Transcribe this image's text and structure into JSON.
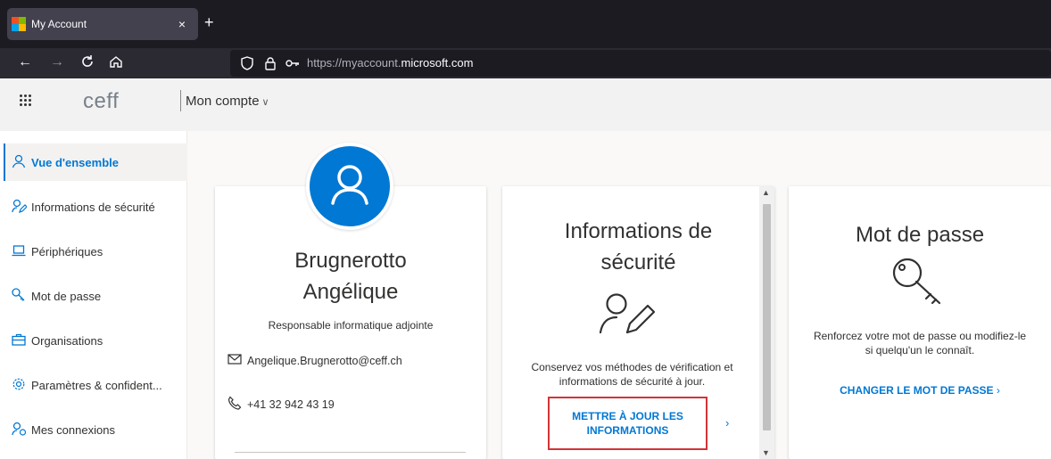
{
  "browser": {
    "tab_title": "My Account",
    "tab_close": "×",
    "new_tab": "+",
    "url_prefix": "https://myaccount.",
    "url_domain": "microsoft.com"
  },
  "header": {
    "brand": "ceff",
    "account_menu": "Mon compte"
  },
  "sidebar": {
    "items": [
      {
        "label": "Vue d'ensemble",
        "icon": "person-icon",
        "active": true
      },
      {
        "label": "Informations de sécurité",
        "icon": "security-info-icon"
      },
      {
        "label": "Périphériques",
        "icon": "laptop-icon"
      },
      {
        "label": "Mot de passe",
        "icon": "key-icon"
      },
      {
        "label": "Organisations",
        "icon": "briefcase-icon"
      },
      {
        "label": "Paramètres & confident...",
        "icon": "gear-icon"
      },
      {
        "label": "Mes connexions",
        "icon": "sign-ins-icon"
      }
    ]
  },
  "profile": {
    "last_name": "Brugnerotto",
    "first_name": "Angélique",
    "job_title": "Responsable informatique adjointe",
    "email": "Angelique.Brugnerotto@ceff.ch",
    "phone": "+41 32 942 43 19"
  },
  "security_card": {
    "title_line1": "Informations de",
    "title_line2": "sécurité",
    "desc_line1": "Conservez vos méthodes de vérification et",
    "desc_line2": "informations de sécurité à jour.",
    "button_line1": "METTRE À JOUR LES",
    "button_line2": "INFORMATIONS"
  },
  "password_card": {
    "title": "Mot de passe",
    "desc_line1": "Renforcez votre mot de passe ou modifiez-le",
    "desc_line2": "si quelqu'un le connaît.",
    "link": "CHANGER LE MOT DE PASSE"
  },
  "colors": {
    "accent": "#0078d4",
    "highlight_border": "#d13438"
  }
}
